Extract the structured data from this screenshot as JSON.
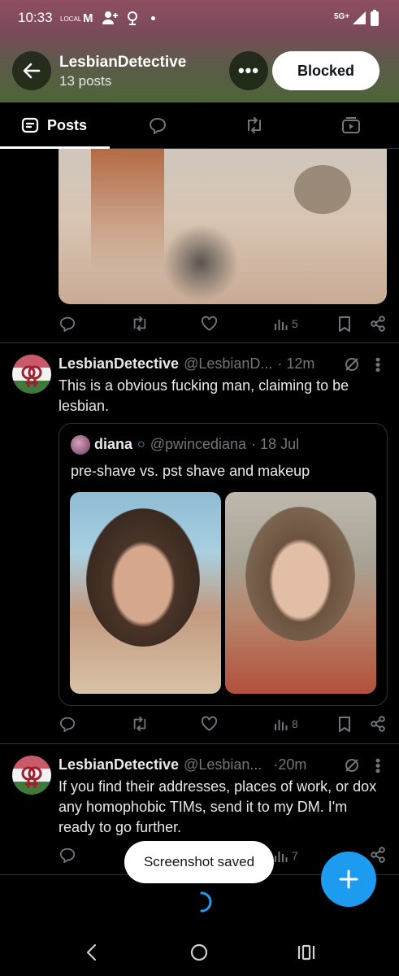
{
  "status_bar": {
    "time": "10:33",
    "local_label": "LOCAL",
    "network": "5G+"
  },
  "header": {
    "title": "LesbianDetective",
    "subtitle": "13 posts",
    "blocked_label": "Blocked"
  },
  "tabs": [
    {
      "label": "Posts"
    }
  ],
  "post1": {
    "views": "5"
  },
  "post2": {
    "name": "LesbianDetective",
    "handle": "@LesbianD...",
    "time": "· 12m",
    "text": "This is a obvious fucking man, claiming to be lesbian.",
    "quote": {
      "name": "diana",
      "handle": "@pwincediana",
      "time": "· 18 Jul",
      "text": "pre-shave vs. pst shave and makeup"
    },
    "views": "8"
  },
  "post3": {
    "name": "LesbianDetective",
    "handle": "@Lesbian...",
    "time": "·20m",
    "text": "If you find their addresses, places of work, or dox any homophobic TIMs, send it to my DM. I'm ready to go further.",
    "views": "7"
  },
  "toast": {
    "text": "Screenshot saved"
  },
  "colors": {
    "accent": "#1d9bf0",
    "muted": "#71767b",
    "background": "#000000"
  }
}
